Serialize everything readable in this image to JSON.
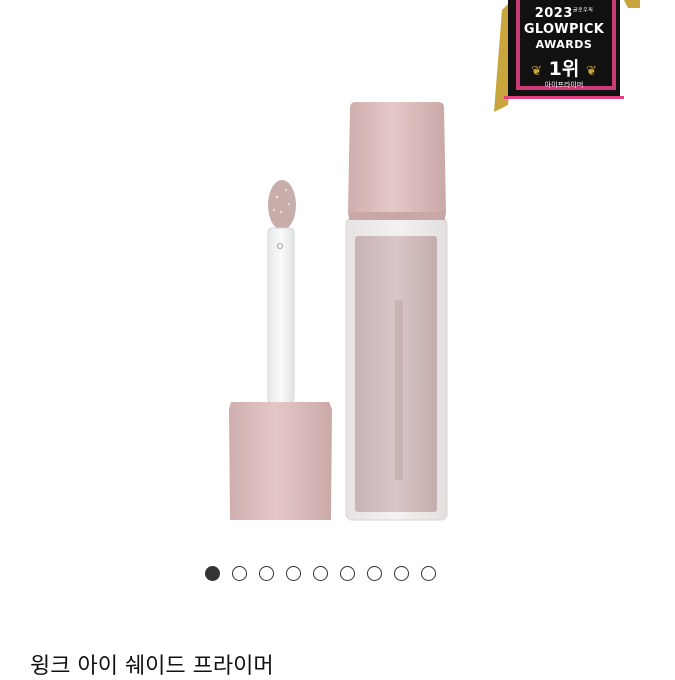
{
  "badge": {
    "year": "2023",
    "year_small": "글로우픽",
    "line1": "GLOWPICK",
    "line2": "AWARDS",
    "rank": "1위",
    "category": "아이프라이머"
  },
  "carousel": {
    "total": 9,
    "active_index": 0
  },
  "product": {
    "title": "윙크 아이 쉐이드 프라이머"
  },
  "colors": {
    "cap_pink": "#d9b9b9",
    "badge_black": "#111111",
    "badge_gold": "#c8a53d",
    "badge_pink": "#e2407f"
  }
}
